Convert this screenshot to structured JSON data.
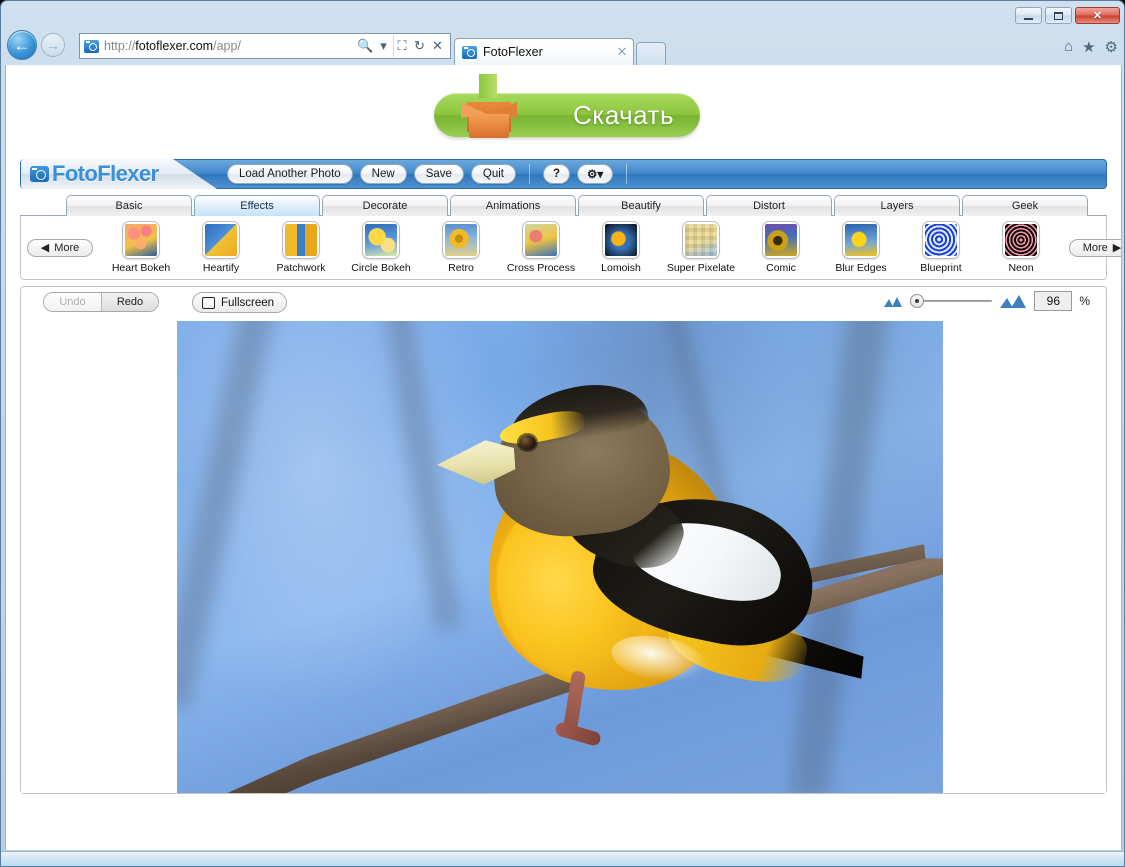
{
  "browser": {
    "window_buttons": {
      "minimize": "minimize-button",
      "maximize": "maximize-button",
      "close": "✕"
    },
    "back_glyph": "←",
    "forward_glyph": "→",
    "url_prefix": "http://",
    "url_domain": "fotoflexer.com",
    "url_path": "/app/",
    "url_icons": {
      "search": "search-icon",
      "search_caret": "▾",
      "compat": "compatibility-view-icon",
      "refresh": "↻",
      "stop": "✕"
    },
    "tab": {
      "title": "FotoFlexer",
      "close": "✕"
    },
    "chrome_icons": {
      "home": "⌂",
      "favorites": "★",
      "tools": "⚙"
    }
  },
  "ad": {
    "download_label": "Скачать"
  },
  "app": {
    "brand": "FotoFlexer",
    "toolbar_buttons": [
      {
        "label": "Load Another Photo"
      },
      {
        "label": "New"
      },
      {
        "label": "Save"
      },
      {
        "label": "Quit"
      }
    ],
    "help_label": "?",
    "settings_label": "⚙▾"
  },
  "tabs": [
    {
      "label": "Basic",
      "active": false
    },
    {
      "label": "Effects",
      "active": true
    },
    {
      "label": "Decorate",
      "active": false
    },
    {
      "label": "Animations",
      "active": false
    },
    {
      "label": "Beautify",
      "active": false
    },
    {
      "label": "Distort",
      "active": false
    },
    {
      "label": "Layers",
      "active": false
    },
    {
      "label": "Geek",
      "active": false
    }
  ],
  "effects": {
    "more_prev_label": "More",
    "more_prev_arrow": "◀",
    "more_next_label": "More",
    "more_next_arrow": "▶",
    "items": [
      {
        "label": "Heart Bokeh"
      },
      {
        "label": "Heartify"
      },
      {
        "label": "Patchwork"
      },
      {
        "label": "Circle Bokeh"
      },
      {
        "label": "Retro"
      },
      {
        "label": "Cross Process"
      },
      {
        "label": "Lomoish"
      },
      {
        "label": "Super Pixelate"
      },
      {
        "label": "Comic"
      },
      {
        "label": "Blur Edges"
      },
      {
        "label": "Blueprint"
      },
      {
        "label": "Neon"
      }
    ]
  },
  "editor": {
    "undo_label": "Undo",
    "undo_disabled": true,
    "redo_label": "Redo",
    "fullscreen_label": "Fullscreen",
    "zoom_value": "96",
    "zoom_unit": "%"
  },
  "colors": {
    "accent_blue": "#3f86c9",
    "active_tab_blue": "#c7e2f8",
    "download_green": "#8dc63f",
    "box_orange": "#e98a3c",
    "window_chrome": "#c3d8ea"
  }
}
